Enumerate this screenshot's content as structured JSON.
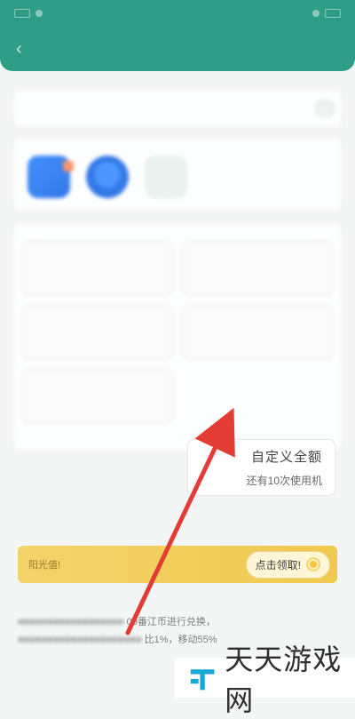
{
  "custom_amount": {
    "title": "自定义全额",
    "subtitle": "还有10次使用机"
  },
  "banner": {
    "text": "阳光值!",
    "claim_label": "点击领取!"
  },
  "footer": {
    "line1": "00番江币进行兑换，",
    "line2": "比1%，移动55%"
  },
  "watermark": {
    "text": "天天游戏网"
  },
  "colors": {
    "accent": "#2f9d86",
    "annotation_arrow": "#e23c34",
    "banner": "#f0c94f"
  }
}
